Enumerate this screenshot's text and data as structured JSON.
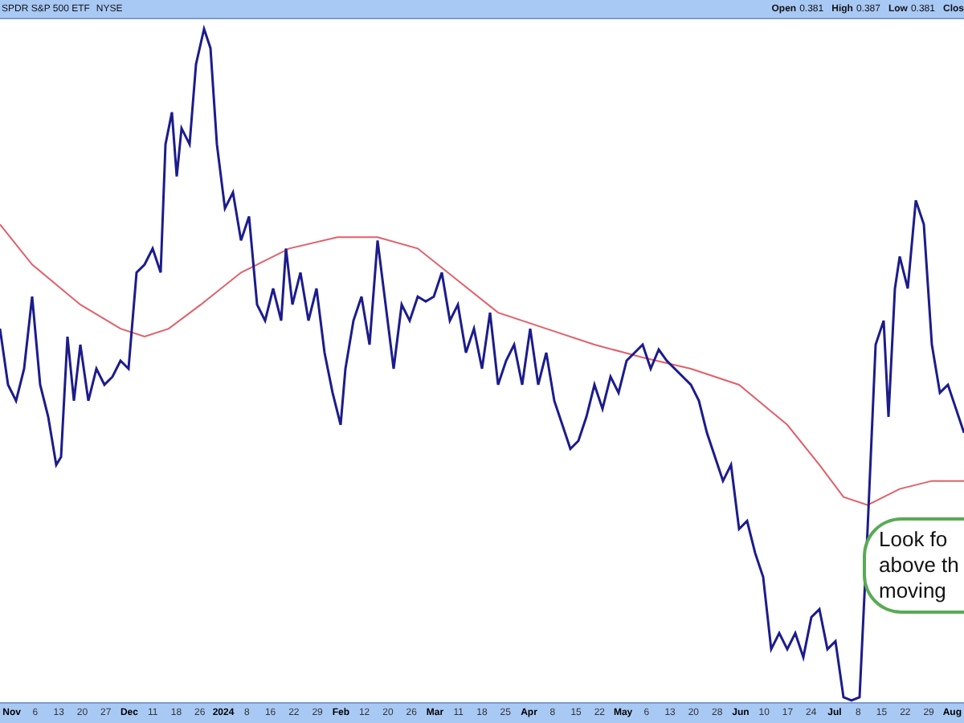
{
  "header": {
    "symbol": "SPDR S&P 500 ETF",
    "exchange": "NYSE",
    "quote": [
      {
        "label": "Open",
        "value": "0.381"
      },
      {
        "label": "High",
        "value": "0.387"
      },
      {
        "label": "Low",
        "value": "0.381"
      },
      {
        "label": "Clos"
      }
    ]
  },
  "callout": {
    "lines": [
      "Look fo",
      "above th",
      "moving"
    ]
  },
  "x_axis": {
    "labels": [
      {
        "text": "Nov",
        "kind": "month"
      },
      {
        "text": "6",
        "kind": "day"
      },
      {
        "text": "13",
        "kind": "day"
      },
      {
        "text": "20",
        "kind": "day"
      },
      {
        "text": "27",
        "kind": "day"
      },
      {
        "text": "Dec",
        "kind": "month"
      },
      {
        "text": "11",
        "kind": "day"
      },
      {
        "text": "18",
        "kind": "day"
      },
      {
        "text": "26",
        "kind": "day"
      },
      {
        "text": "2024",
        "kind": "month"
      },
      {
        "text": "8",
        "kind": "day"
      },
      {
        "text": "16",
        "kind": "day"
      },
      {
        "text": "22",
        "kind": "day"
      },
      {
        "text": "29",
        "kind": "day"
      },
      {
        "text": "Feb",
        "kind": "month"
      },
      {
        "text": "12",
        "kind": "day"
      },
      {
        "text": "20",
        "kind": "day"
      },
      {
        "text": "26",
        "kind": "day"
      },
      {
        "text": "Mar",
        "kind": "month"
      },
      {
        "text": "11",
        "kind": "day"
      },
      {
        "text": "18",
        "kind": "day"
      },
      {
        "text": "25",
        "kind": "day"
      },
      {
        "text": "Apr",
        "kind": "month"
      },
      {
        "text": "8",
        "kind": "day"
      },
      {
        "text": "15",
        "kind": "day"
      },
      {
        "text": "22",
        "kind": "day"
      },
      {
        "text": "May",
        "kind": "month"
      },
      {
        "text": "6",
        "kind": "day"
      },
      {
        "text": "13",
        "kind": "day"
      },
      {
        "text": "20",
        "kind": "day"
      },
      {
        "text": "28",
        "kind": "day"
      },
      {
        "text": "Jun",
        "kind": "month"
      },
      {
        "text": "10",
        "kind": "day"
      },
      {
        "text": "17",
        "kind": "day"
      },
      {
        "text": "24",
        "kind": "day"
      },
      {
        "text": "Jul",
        "kind": "month"
      },
      {
        "text": "8",
        "kind": "day"
      },
      {
        "text": "15",
        "kind": "day"
      },
      {
        "text": "22",
        "kind": "day"
      },
      {
        "text": "29",
        "kind": "day"
      },
      {
        "text": "Aug",
        "kind": "month"
      }
    ]
  }
}
